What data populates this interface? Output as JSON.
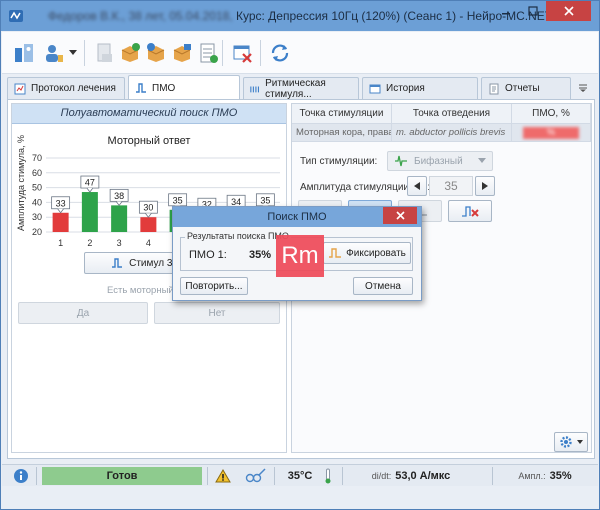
{
  "window": {
    "title_redacted": "Федоров В.К., 38 лет, 05.04.2018,",
    "title": "Курс: Депрессия 10Гц (120%) (Сеанс 1) - Нейро-МС.NET",
    "controls": [
      "minimize-icon",
      "maximize-icon",
      "close-icon"
    ]
  },
  "tabs": [
    {
      "label": "Протокол лечения",
      "icon": "protocol-icon"
    },
    {
      "label": "ПМО",
      "icon": "pulse-icon",
      "active": true
    },
    {
      "label": "Ритмическая стимуля...",
      "icon": "rhythm-icon"
    },
    {
      "label": "История",
      "icon": "history-icon"
    },
    {
      "label": "Отчеты",
      "icon": "report-icon"
    }
  ],
  "left": {
    "header": "Полуавтоматический поиск ПМО",
    "motor_question": "Есть моторный ответ?",
    "yes": "Да",
    "no": "Нет",
    "stimulate": "Стимул 35%"
  },
  "chart_data": {
    "type": "bar",
    "title": "Моторный ответ",
    "ylabel": "Амплитуда стимула, %",
    "categories": [
      "1",
      "2",
      "3",
      "4",
      "5",
      "6",
      "7",
      "8"
    ],
    "values": [
      33,
      47,
      38,
      30,
      35,
      32,
      34,
      35
    ],
    "value_labels": [
      "33",
      "47",
      "38",
      "30",
      "35",
      "32",
      "34",
      "35"
    ],
    "motor_response": [
      false,
      true,
      true,
      false,
      true,
      false,
      false,
      true
    ],
    "colors": {
      "response": "#2ea34a",
      "no_response": "#e23b3b"
    },
    "ylim": [
      20,
      70
    ],
    "yticks": [
      "20",
      "30",
      "40",
      "50",
      "60",
      "70"
    ],
    "grid": true
  },
  "right": {
    "columns": [
      "Точка стимуляции",
      "Точка отведения",
      "ПМО, %"
    ],
    "row": [
      "Моторная кора, правая р...",
      "m. abductor pollicis brevis",
      "%"
    ],
    "stim_type_label": "Тип стимуляции:",
    "stim_type_value": "Бифазный",
    "amplitude_label": "Амплитуда стимуляции (%):",
    "amplitude_value": "35"
  },
  "dialog": {
    "title": "Поиск ПМО",
    "group_label": "Результаты поиска ПМО",
    "pmo_label": "ПМО 1:",
    "pmo_value": "35%",
    "fix_button": "Фиксировать",
    "repeat_button": "Повторить...",
    "cancel_button": "Отмена"
  },
  "watermark": "Rm",
  "status": {
    "ready": "Готов",
    "temperature": "35°C",
    "didt_label": "di/dt:",
    "didt_value": "53,0 А/мкс",
    "ampl_label": "Ампл.:",
    "ampl_value": "35%",
    "ready_color": "#8ecb8e"
  }
}
